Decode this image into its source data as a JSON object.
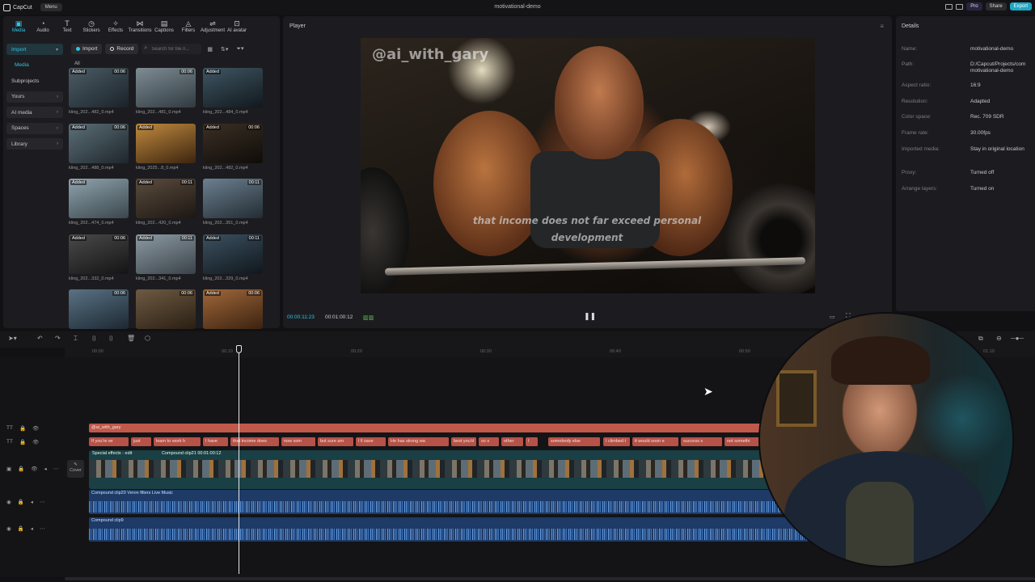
{
  "app": {
    "name": "CapCut",
    "menu_label": "Menu",
    "project_title": "motivational-demo"
  },
  "topright": {
    "pro_label": "Pro",
    "share_label": "Share",
    "export_label": "Export"
  },
  "tools": [
    {
      "label": "Media",
      "icon": "media-icon"
    },
    {
      "label": "Audio",
      "icon": "audio-icon"
    },
    {
      "label": "Text",
      "icon": "text-icon"
    },
    {
      "label": "Stickers",
      "icon": "stickers-icon"
    },
    {
      "label": "Effects",
      "icon": "effects-icon"
    },
    {
      "label": "Transitions",
      "icon": "transitions-icon"
    },
    {
      "label": "Captions",
      "icon": "captions-icon"
    },
    {
      "label": "Filters",
      "icon": "filters-icon"
    },
    {
      "label": "Adjustment",
      "icon": "adjustment-icon"
    },
    {
      "label": "AI avatar",
      "icon": "ai-avatar-icon"
    }
  ],
  "sidebar": {
    "import": "Import",
    "media": "Media",
    "subprojects": "Subprojects",
    "yours": "Yours",
    "ai_media": "AI media",
    "spaces": "Spaces",
    "library": "Library"
  },
  "media_toolbar": {
    "import_label": "Import",
    "record_label": "Record",
    "search_placeholder": "Search for file n..."
  },
  "media": {
    "all_label": "All",
    "added_label": "Added",
    "items": [
      {
        "name": "kling_202...482_0.mp4",
        "dur": "00:06",
        "added": true
      },
      {
        "name": "kling_202...481_0.mp4",
        "dur": "00:06",
        "added": false
      },
      {
        "name": "kling_202...484_0.mp4",
        "dur": "",
        "added": true
      },
      {
        "name": "kling_202...488_0.mp4",
        "dur": "00:06",
        "added": true
      },
      {
        "name": "kling_2025...8_0.mp4",
        "dur": "",
        "added": true
      },
      {
        "name": "kling_202...482_0.mp4",
        "dur": "00:06",
        "added": true
      },
      {
        "name": "kling_202...474_0.mp4",
        "dur": "",
        "added": true
      },
      {
        "name": "kling_202...420_0.mp4",
        "dur": "00:11",
        "added": true
      },
      {
        "name": "kling_202...351_0.mp4",
        "dur": "00:11",
        "added": false
      },
      {
        "name": "kling_202...332_0.mp4",
        "dur": "00:06",
        "added": true
      },
      {
        "name": "kling_202...341_0.mp4",
        "dur": "00:11",
        "added": true
      },
      {
        "name": "kling_202...329_0.mp4",
        "dur": "00:11",
        "added": true
      },
      {
        "name": "",
        "dur": "00:06",
        "added": false
      },
      {
        "name": "",
        "dur": "00:06",
        "added": false
      },
      {
        "name": "",
        "dur": "00:06",
        "added": true
      }
    ]
  },
  "player": {
    "title": "Player",
    "watermark": "@ai_with_gary",
    "subtitle": "that income does not far exceed personal development",
    "time_current": "00:00:11:23",
    "time_total": "00:01:00:12"
  },
  "details": {
    "title": "Details",
    "rows": [
      {
        "k": "Name:",
        "v": "motivational-demo"
      },
      {
        "k": "Path:",
        "v": "D:/Capcut/Projects/com motivational-demo"
      },
      {
        "k": "Aspect ratio:",
        "v": "16:9"
      },
      {
        "k": "Resolution:",
        "v": "Adapted"
      },
      {
        "k": "Color space:",
        "v": "Rec. 709 SDR"
      },
      {
        "k": "Frame rate:",
        "v": "30.00fps"
      },
      {
        "k": "Imported media:",
        "v": "Stay in original location"
      },
      {
        "k": "Proxy:",
        "v": "Turned off"
      },
      {
        "k": "Arrange layers:",
        "v": "Turned on"
      }
    ]
  },
  "ruler": [
    "00:00",
    "00:10",
    "00:20",
    "00:30",
    "00:40",
    "00:50",
    "01:10"
  ],
  "timeline": {
    "title_clip": "@ai_with_gary",
    "text_clips": [
      "If you're wr",
      "just",
      "learn to work h",
      "I have",
      "that income does",
      "now som",
      "but sure am",
      "I ll save",
      "He has strong wa",
      "best you'd",
      "so s",
      "other",
      "I",
      "somebody else",
      "I climbed t",
      "it would soon e",
      "success s",
      "not somethi"
    ],
    "video_label": "Special effects - edit",
    "compound_label": "Compound clip21",
    "compound_dur": "00:01:00:12",
    "cover_label": "Cover",
    "audio1_label": "Compound clip20",
    "audio1_sub": "Veron filters Live Music",
    "audio2_label": "Compound clip9"
  }
}
